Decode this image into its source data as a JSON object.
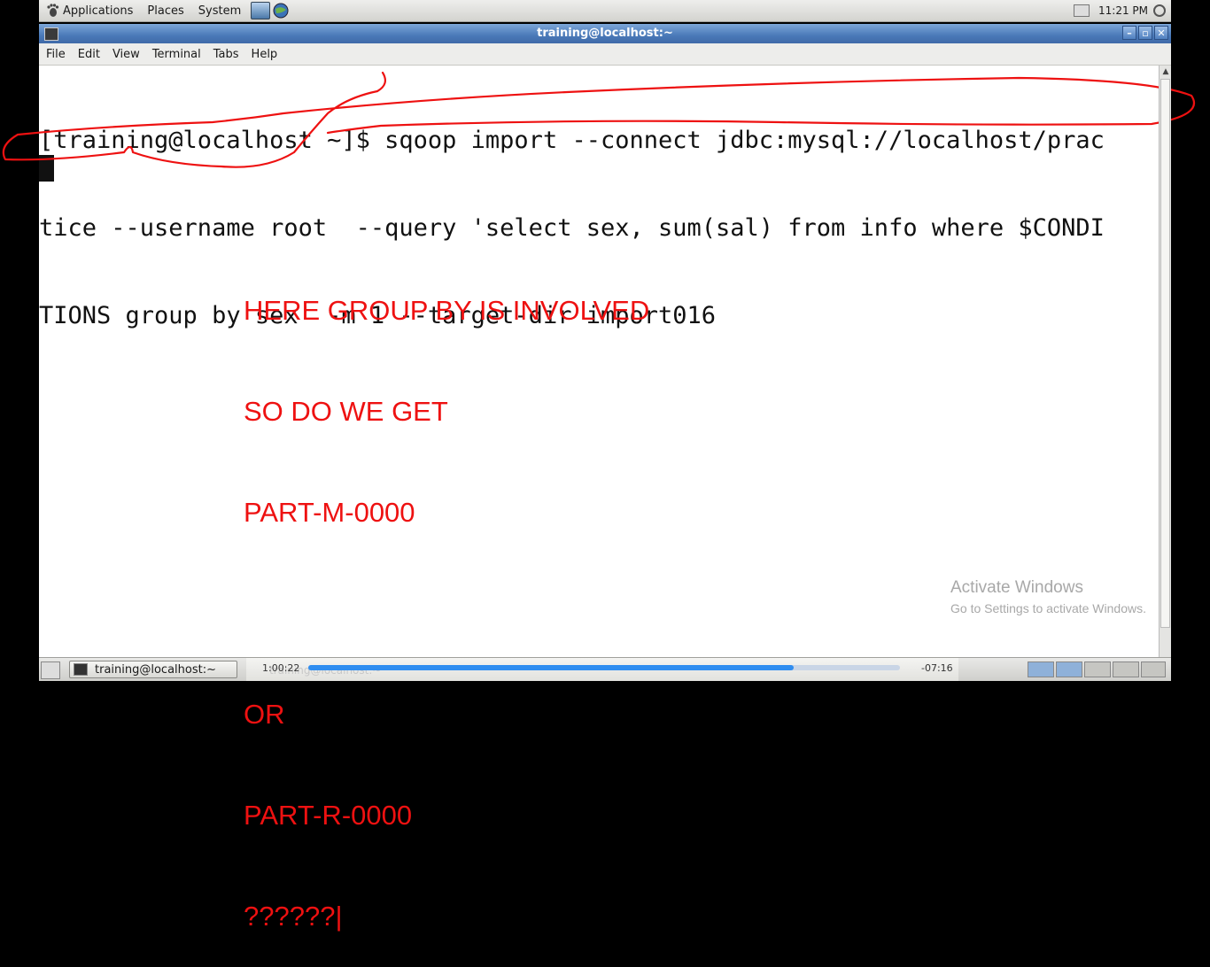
{
  "top_panel": {
    "menus": [
      "Applications",
      "Places",
      "System"
    ],
    "clock": "11:21 PM"
  },
  "window": {
    "title": "training@localhost:~"
  },
  "menubar": {
    "items": [
      "File",
      "Edit",
      "View",
      "Terminal",
      "Tabs",
      "Help"
    ]
  },
  "terminal": {
    "lines": [
      "[training@localhost ~]$ sqoop import --connect jdbc:mysql://localhost/prac",
      "tice --username root  --query 'select sex, sum(sal) from info where $CONDI",
      "TIONS group by sex' -m 1 --target-dir import016"
    ]
  },
  "annotation": {
    "lines": [
      "HERE GROUP BY IS INVOLVED",
      "SO DO WE GET",
      "PART-M-0000",
      "",
      "OR",
      "PART-R-0000",
      "??????|"
    ],
    "color": "#ee1111"
  },
  "watermark": {
    "title": "Activate Windows",
    "subtitle": "Go to Settings to activate Windows."
  },
  "bottom_panel": {
    "task_label": "training@localhost:~",
    "ghost_label": "training@localhost:~",
    "elapsed": "1:00:22",
    "remaining": "-07:16",
    "progress_fraction": 0.82
  }
}
